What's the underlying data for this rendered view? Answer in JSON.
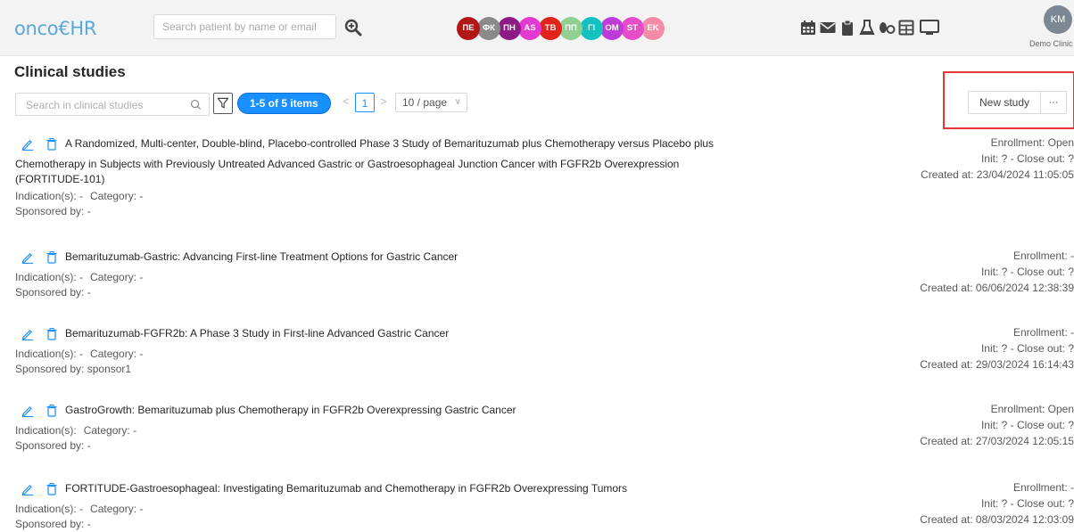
{
  "header": {
    "logo_text": "onco€HR",
    "search_placeholder": "Search patient by name or email",
    "avatars": [
      {
        "label": "ПЕ",
        "color": "#b11717"
      },
      {
        "label": "ФК",
        "color": "#8a8a8a"
      },
      {
        "label": "ПН",
        "color": "#8e1a86"
      },
      {
        "label": "AS",
        "color": "#e23ad1"
      },
      {
        "label": "TB",
        "color": "#e0241b"
      },
      {
        "label": "ПП",
        "color": "#8fcf8f"
      },
      {
        "label": "ГІ",
        "color": "#13c1c1"
      },
      {
        "label": "OM",
        "color": "#c03ad7"
      },
      {
        "label": "ST",
        "color": "#e64ec9"
      },
      {
        "label": "EK",
        "color": "#f48ca8"
      }
    ],
    "user_initials": "KM",
    "clinic_name": "Demo Clinic"
  },
  "page": {
    "title": "Clinical studies",
    "search_placeholder": "Search in clinical studies",
    "items_label": "1-5 of 5 items",
    "current_page": "1",
    "page_size": "10 / page",
    "new_study_label": "New study",
    "more_label": "···"
  },
  "studies": [
    {
      "title_line1": "A Randomized, Multi-center, Double-blind, Placebo-controlled Phase 3 Study of Bemarituzumab plus Chemotherapy versus Placebo plus",
      "title_line2": "Chemotherapy in Subjects with Previously Untreated Advanced Gastric or Gastroesophageal Junction Cancer with FGFR2b Overexpression (FORTITUDE-101)",
      "indication": "Indication(s): -",
      "category": "Category: -",
      "sponsor": "Sponsored by: -",
      "enrollment": "Enrollment: Open",
      "init_close": "Init: ? - Close out: ?",
      "created": "Created at: 23/04/2024 11:05:05"
    },
    {
      "title_line1": "Bemarituzumab-Gastric: Advancing First-line Treatment Options for Gastric Cancer",
      "title_line2": "",
      "indication": "Indication(s): -",
      "category": "Category: -",
      "sponsor": "Sponsored by: -",
      "enrollment": "Enrollment: -",
      "init_close": "Init: ? - Close out: ?",
      "created": "Created at: 06/06/2024 12:38:39"
    },
    {
      "title_line1": "Bemarituzumab-FGFR2b: A Phase 3 Study in First-line Advanced Gastric Cancer",
      "title_line2": "",
      "indication": "Indication(s): -",
      "category": "Category: -",
      "sponsor": "Sponsored by: sponsor1",
      "enrollment": "Enrollment: -",
      "init_close": "Init: ? - Close out: ?",
      "created": "Created at: 29/03/2024 16:14:43"
    },
    {
      "title_line1": "GastroGrowth: Bemarituzumab plus Chemotherapy in FGFR2b Overexpressing Gastric Cancer",
      "title_line2": "",
      "indication": "Indication(s):",
      "category": "Category: -",
      "sponsor": "Sponsored by: -",
      "enrollment": "Enrollment: Open",
      "init_close": "Init: ? - Close out: ?",
      "created": "Created at: 27/03/2024 12:05:15"
    },
    {
      "title_line1": "FORTITUDE-Gastroesophageal: Investigating Bemarituzumab and Chemotherapy in FGFR2b Overexpressing Tumors",
      "title_line2": "",
      "indication": "Indication(s): -",
      "category": "Category: -",
      "sponsor": "Sponsored by: -",
      "enrollment": "Enrollment: -",
      "init_close": "Init: ? - Close out: ?",
      "created": "Created at: 08/03/2024 12:03:09"
    }
  ]
}
